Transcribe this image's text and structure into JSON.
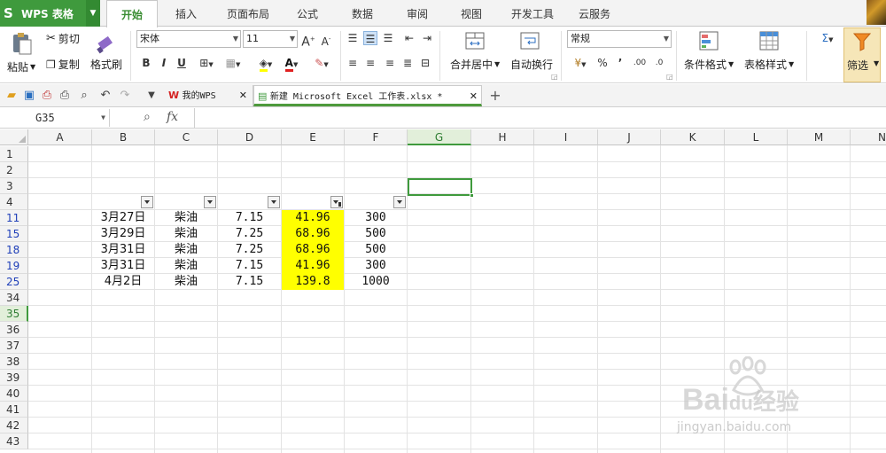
{
  "app": {
    "logo_s": "S",
    "logo_text": "WPS 表格",
    "menu": [
      "开始",
      "插入",
      "页面布局",
      "公式",
      "数据",
      "审阅",
      "视图",
      "开发工具",
      "云服务"
    ],
    "active_menu": "开始"
  },
  "ribbon": {
    "paste": "粘贴",
    "cut": "剪切",
    "copy": "复制",
    "format_painter": "格式刷",
    "font_name": "宋体",
    "font_size": "11",
    "merge_center": "合并居中",
    "auto_wrap": "自动换行",
    "number_format": "常规",
    "percent": "%",
    "comma": "’",
    "cond_format": "条件格式",
    "table_style": "表格样式",
    "filter": "筛选",
    "sum": "Σ",
    "bold": "B",
    "italic": "I",
    "underline": "U",
    "font_color_letter": "A",
    "inc_font": "A",
    "dec_font": "A"
  },
  "tabs": [
    {
      "label": "我的WPS",
      "active": false
    },
    {
      "label": "新建 Microsoft Excel 工作表.xlsx *",
      "active": true
    }
  ],
  "formula_bar": {
    "name_box": "G35",
    "fx": "fx",
    "value": ""
  },
  "sheet": {
    "columns": [
      "A",
      "B",
      "C",
      "D",
      "E",
      "F",
      "G",
      "H",
      "I",
      "J",
      "K",
      "L",
      "M",
      "N"
    ],
    "selected_column": "G",
    "rows": [
      "1",
      "2",
      "3",
      "4",
      "11",
      "15",
      "18",
      "19",
      "25",
      "34",
      "35",
      "36",
      "37",
      "38",
      "39",
      "40",
      "41",
      "42",
      "43"
    ],
    "filtered_rows": [
      "11",
      "15",
      "18",
      "19",
      "25"
    ],
    "selected_row": "35",
    "selected_cell": "G35",
    "data": [
      {
        "date": "3月27日",
        "fuel": "柴油",
        "price": "7.15",
        "amount": "41.96",
        "qty": "300"
      },
      {
        "date": "3月29日",
        "fuel": "柴油",
        "price": "7.25",
        "amount": "68.96",
        "qty": "500"
      },
      {
        "date": "3月31日",
        "fuel": "柴油",
        "price": "7.25",
        "amount": "68.96",
        "qty": "500"
      },
      {
        "date": "3月31日",
        "fuel": "柴油",
        "price": "7.15",
        "amount": "41.96",
        "qty": "300"
      },
      {
        "date": "4月2日",
        "fuel": "柴油",
        "price": "7.15",
        "amount": "139.8",
        "qty": "1000"
      }
    ],
    "highlight_color": "#ffff00",
    "accent_color": "#3f9a3d",
    "filtered_row_color": "#1f3fb8"
  },
  "watermark": {
    "brand": "Bai",
    "brand_suffix": "经验",
    "url": "jingyan.baidu.com"
  }
}
